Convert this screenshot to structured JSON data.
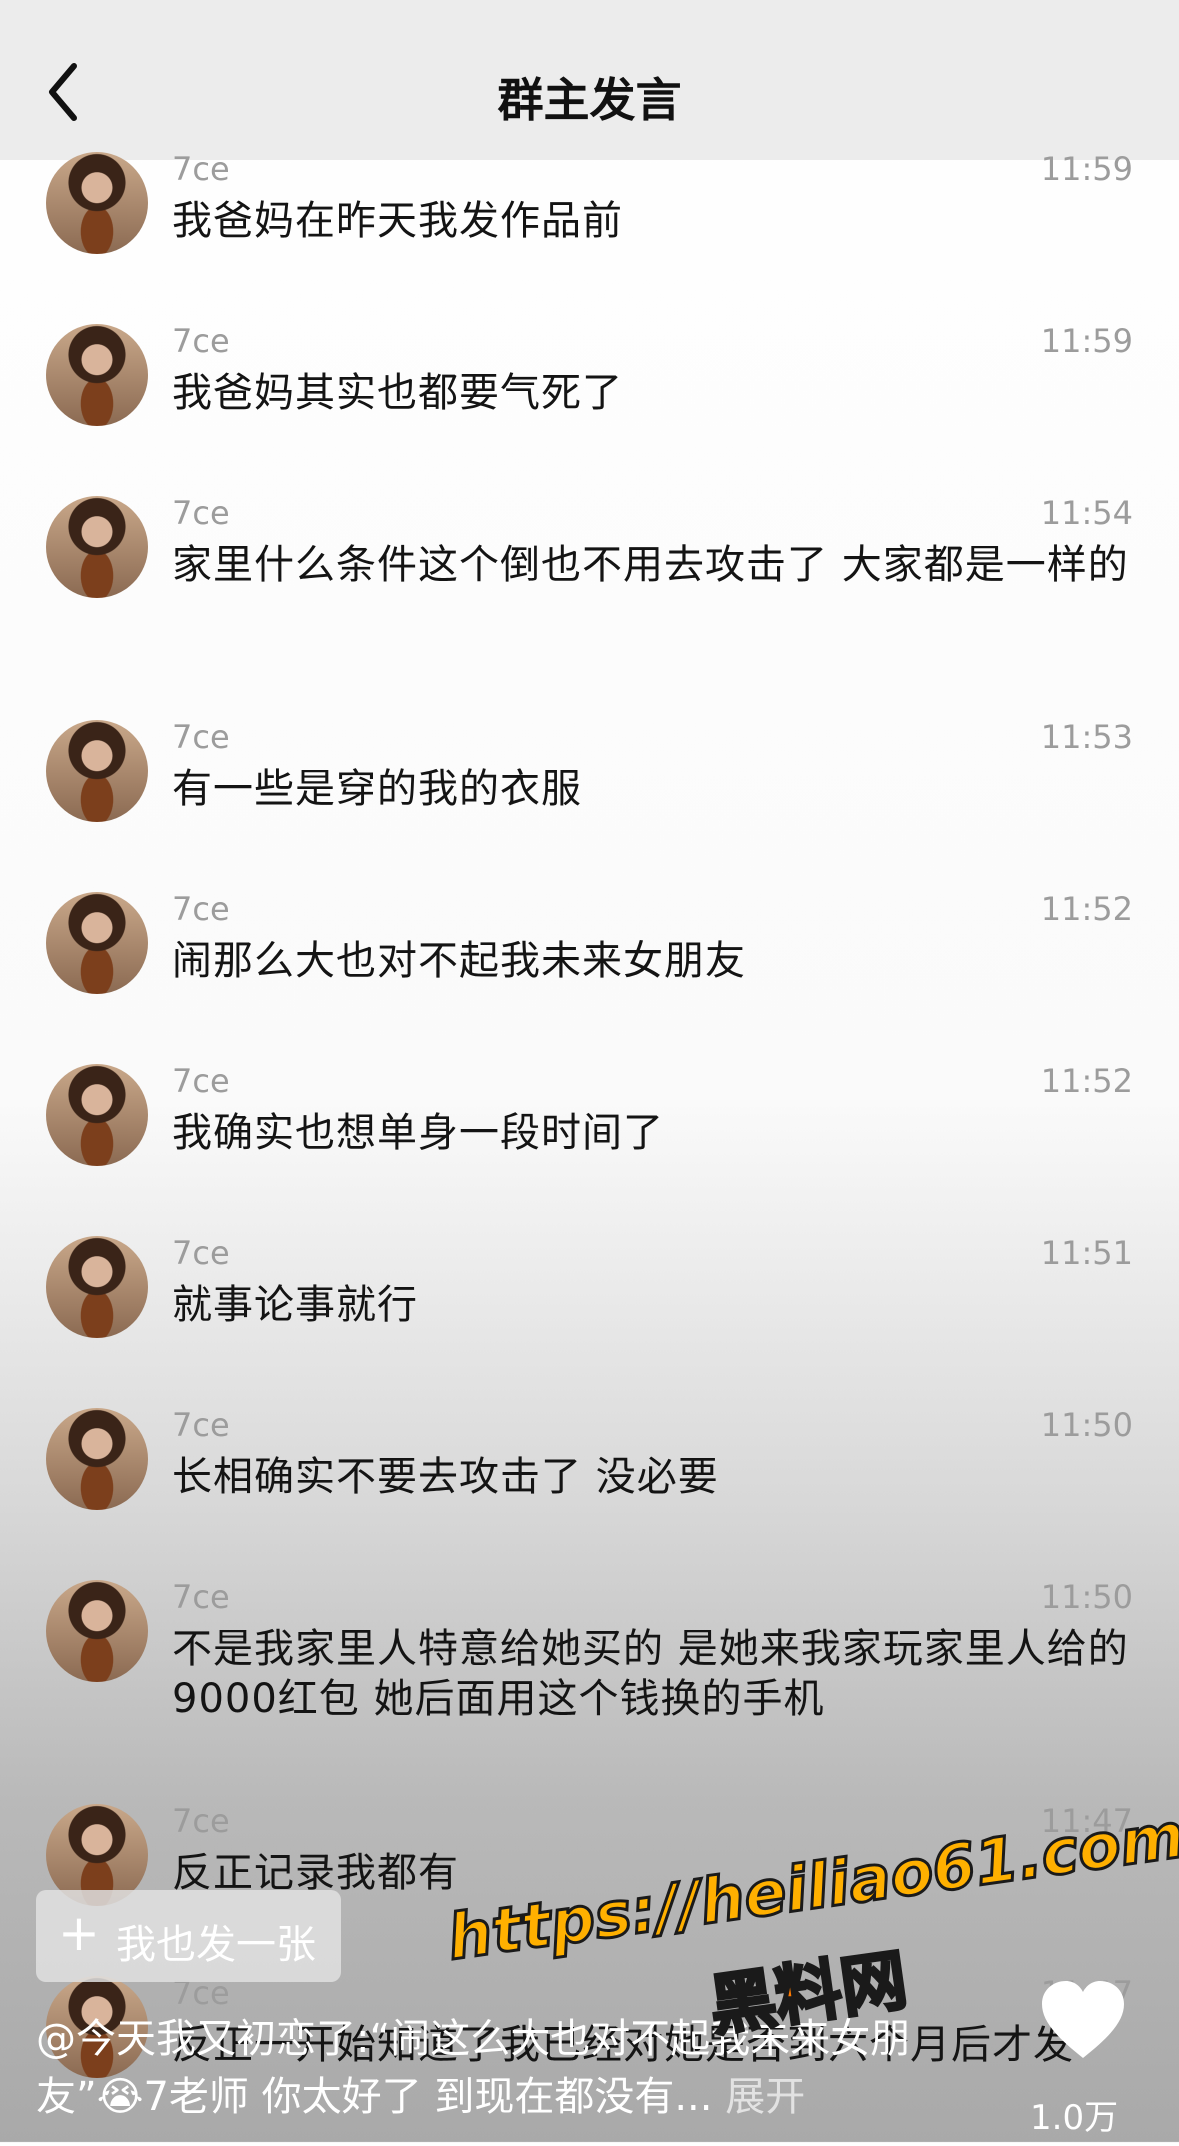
{
  "header": {
    "title": "群主发言"
  },
  "messages": [
    {
      "name": "7ce",
      "time": "11:59",
      "text": "我爸妈在昨天我发作品前"
    },
    {
      "name": "7ce",
      "time": "11:59",
      "text": "我爸妈其实也都要气死了"
    },
    {
      "name": "7ce",
      "time": "11:54",
      "text": "家里什么条件这个倒也不用去攻击了 大家都是一样的"
    },
    {
      "name": "7ce",
      "time": "11:53",
      "text": "有一些是穿的我的衣服"
    },
    {
      "name": "7ce",
      "time": "11:52",
      "text": "闹那么大也对不起我未来女朋友"
    },
    {
      "name": "7ce",
      "time": "11:52",
      "text": "我确实也想单身一段时间了"
    },
    {
      "name": "7ce",
      "time": "11:51",
      "text": "就事论事就行"
    },
    {
      "name": "7ce",
      "time": "11:50",
      "text": "长相确实不要去攻击了 没必要"
    },
    {
      "name": "7ce",
      "time": "11:50",
      "text": "不是我家里人特意给她买的 是她来我家玩家里人给的9000红包 她后面用这个钱换的手机"
    },
    {
      "name": "7ce",
      "time": "11:47",
      "text": "反正记录我都有"
    },
    {
      "name": "7ce",
      "time": "11:47",
      "text": "反正一开始知道了我已经对她是否到六个月后才发"
    }
  ],
  "post_button": {
    "label": "我也发一张"
  },
  "caption": {
    "text": "@今天我又初恋了:“闹这么大也对不起我未来女朋友”😭7老师 你太好了 到现在都没有...",
    "more": "展开"
  },
  "like": {
    "count": "1.0万"
  },
  "watermark": {
    "url": "https://heiliao61.com",
    "site": "黑料网"
  },
  "colors": {
    "header_bg": "#ececec",
    "name": "#9c9c9c",
    "text": "#141414",
    "watermark": "#ffb000"
  }
}
